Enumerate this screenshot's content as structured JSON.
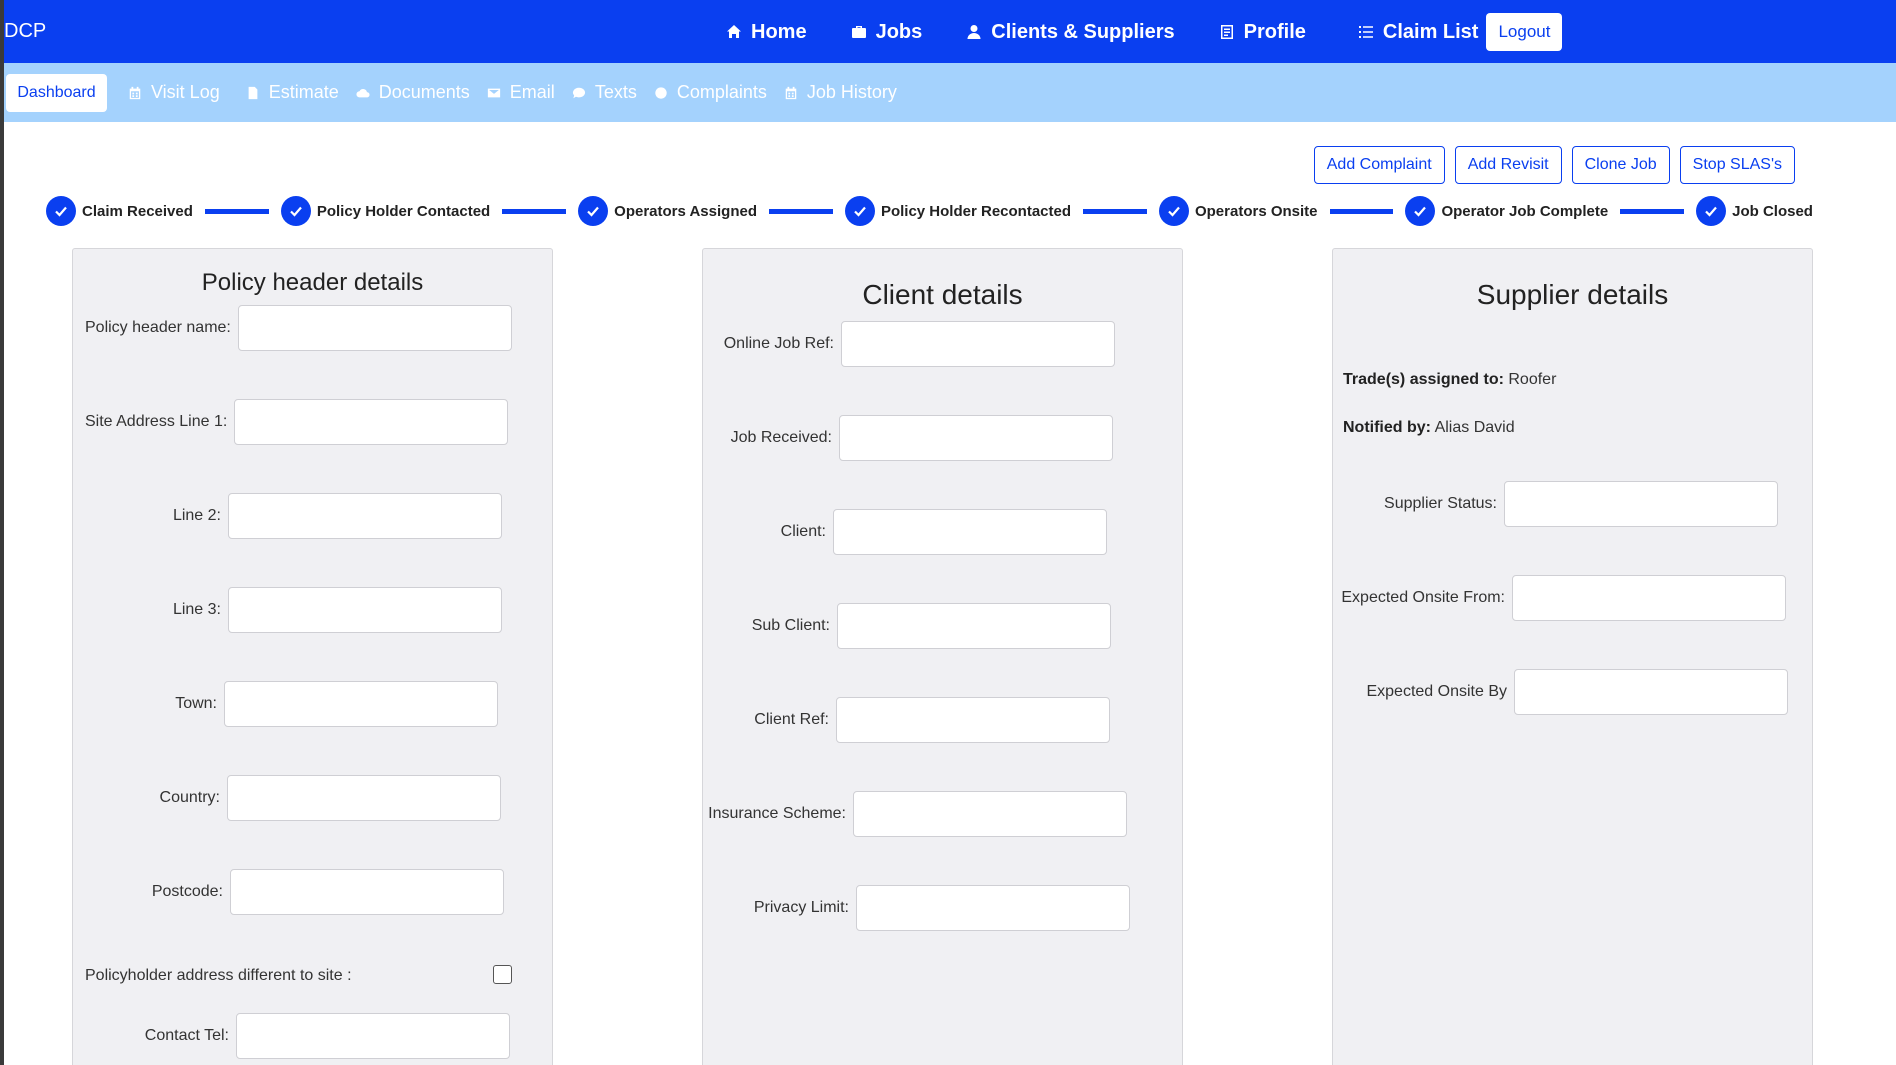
{
  "app": {
    "brand": "DCP"
  },
  "topnav": {
    "items": [
      {
        "label": "Home",
        "icon": "home-icon"
      },
      {
        "label": "Jobs",
        "icon": "briefcase-icon"
      },
      {
        "label": "Clients & Suppliers",
        "icon": "user-icon"
      },
      {
        "label": "Profile",
        "icon": "profile-card-icon"
      },
      {
        "label": "Claim List",
        "icon": "list-icon"
      }
    ],
    "logout": "Logout"
  },
  "subnav": {
    "active": "Dashboard",
    "items": [
      {
        "label": "Visit Log",
        "icon": "calendar-icon"
      },
      {
        "label": "Estimate",
        "icon": "document-icon"
      },
      {
        "label": "Documents",
        "icon": "cloud-icon"
      },
      {
        "label": "Email",
        "icon": "envelope-icon"
      },
      {
        "label": "Texts",
        "icon": "chat-icon"
      },
      {
        "label": "Complaints",
        "icon": "alert-circle-icon"
      },
      {
        "label": "Job History",
        "icon": "calendar-icon"
      }
    ]
  },
  "actions": [
    "Add Complaint",
    "Add Revisit",
    "Clone Job",
    "Stop SLAS's"
  ],
  "progress": {
    "steps": [
      "Claim Received",
      "Policy Holder Contacted",
      "Operators Assigned",
      "Policy Holder Recontacted",
      "Operators Onsite",
      "Operator Job Complete",
      "Job Closed"
    ]
  },
  "policy": {
    "title": "Policy header details",
    "fields": [
      "Policy header name:",
      "Site Address Line 1:",
      "Line 2:",
      "Line 3:",
      "Town:",
      "Country:",
      "Postcode:"
    ],
    "checkbox_label": "Policyholder address different to site :",
    "contact_tel": "Contact Tel:"
  },
  "client": {
    "title": "Client details",
    "fields": [
      "Online Job Ref:",
      "Job Received:",
      "Client:",
      "Sub Client:",
      "Client Ref:",
      "Insurance Scheme:",
      "Privacy Limit:"
    ]
  },
  "supplier": {
    "title": "Supplier details",
    "trades_label": "Trade(s) assigned to:",
    "trades_value": "Roofer",
    "notified_label": "Notified by:",
    "notified_value": "Alias David",
    "fields": [
      "Supplier Status:",
      "Expected Onsite From:",
      "Expected Onsite By"
    ]
  },
  "colors": {
    "primary": "#0a3ff0",
    "subnav": "#a4d2fd",
    "panel": "#f0f0f3"
  }
}
